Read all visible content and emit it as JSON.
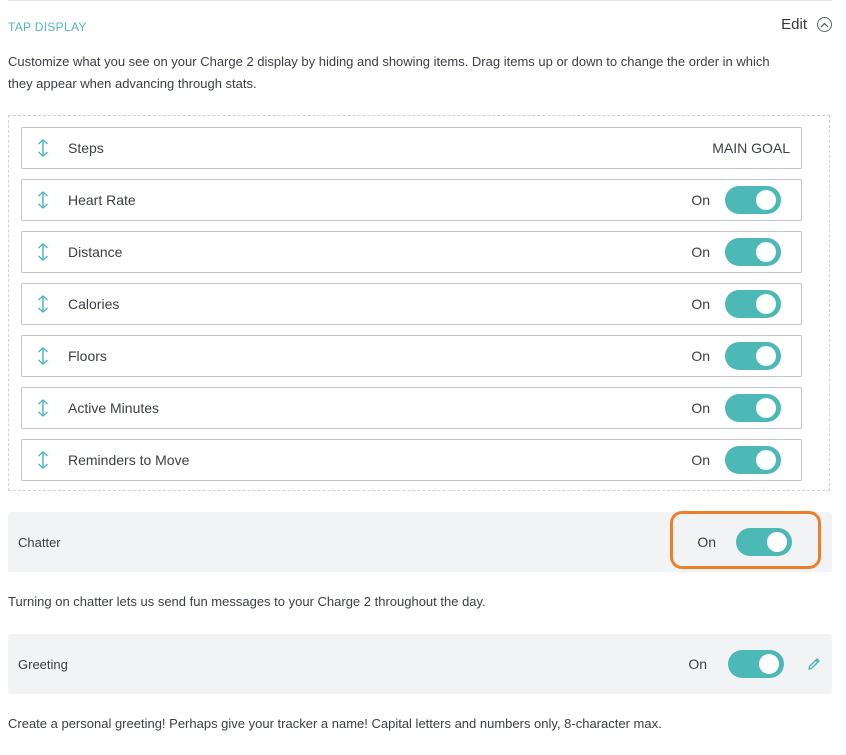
{
  "section": {
    "title": "TAP DISPLAY",
    "edit_label": "Edit",
    "description_line1": "Customize what you see on your Charge 2 display by hiding and showing items. Drag items up or down to change the order in which",
    "description_line2": "they appear when advancing through stats."
  },
  "items": [
    {
      "label": "Steps",
      "status": "MAIN GOAL"
    },
    {
      "label": "Heart Rate",
      "status": "On",
      "enabled": true
    },
    {
      "label": "Distance",
      "status": "On",
      "enabled": true
    },
    {
      "label": "Calories",
      "status": "On",
      "enabled": true
    },
    {
      "label": "Floors",
      "status": "On",
      "enabled": true
    },
    {
      "label": "Active Minutes",
      "status": "On",
      "enabled": true
    },
    {
      "label": "Reminders to Move",
      "status": "On",
      "enabled": true
    }
  ],
  "chatter": {
    "label": "Chatter",
    "status": "On",
    "enabled": true,
    "description": "Turning on chatter lets us send fun messages to your Charge 2 throughout the day."
  },
  "greeting": {
    "label": "Greeting",
    "status": "On",
    "enabled": true,
    "description": "Create a personal greeting! Perhaps give your tracker a name! Capital letters and numbers only, 8-character max."
  },
  "colors": {
    "accent": "#4cb9b6",
    "highlight": "#f07d27",
    "panel_bg": "#f2f3f5"
  }
}
